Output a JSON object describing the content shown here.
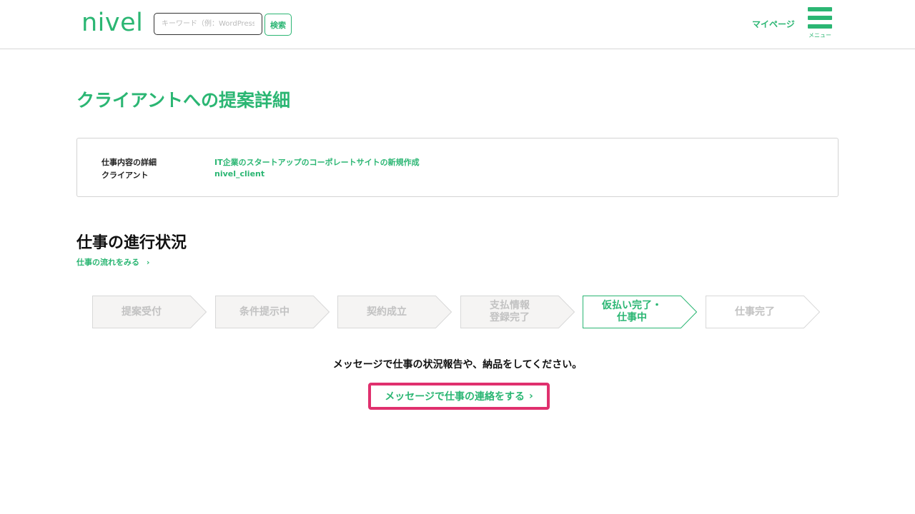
{
  "header": {
    "logo": "nivel",
    "search_placeholder": "キーワード（例：WordPress）",
    "search_button": "検索",
    "mypage": "マイページ",
    "menu_label": "メニュー"
  },
  "page_title": "クライアントへの提案詳細",
  "details": {
    "job_label": "仕事内容の詳細",
    "job_value": "IT企業のスタートアップのコーポレートサイトの新規作成",
    "client_label": "クライアント",
    "client_value": "nivel_client"
  },
  "progress": {
    "title": "仕事の進行状況",
    "flow_link": "仕事の流れをみる",
    "chevron": "›",
    "steps": [
      {
        "label": "提案受付",
        "active": false
      },
      {
        "label": "条件提示中",
        "active": false
      },
      {
        "label": "契約成立",
        "active": false
      },
      {
        "label": "支払情報\n登録完了",
        "active": false
      },
      {
        "label": "仮払い完了・\n仕事中",
        "active": true
      },
      {
        "label": "仕事完了",
        "active": false
      }
    ]
  },
  "instruction": "メッセージで仕事の状況報告や、納品をしてください。",
  "message_button": "メッセージで仕事の連絡をする",
  "colors": {
    "accent": "#2bb673",
    "highlight": "#e0306e",
    "inactive_step_fill": "#f5f4f3",
    "inactive_step_border": "#d8d8d8",
    "inactive_text": "#c2c2c2"
  },
  "icons": {
    "menu": "hamburger-menu-icon",
    "chevron": "chevron-right-icon"
  }
}
